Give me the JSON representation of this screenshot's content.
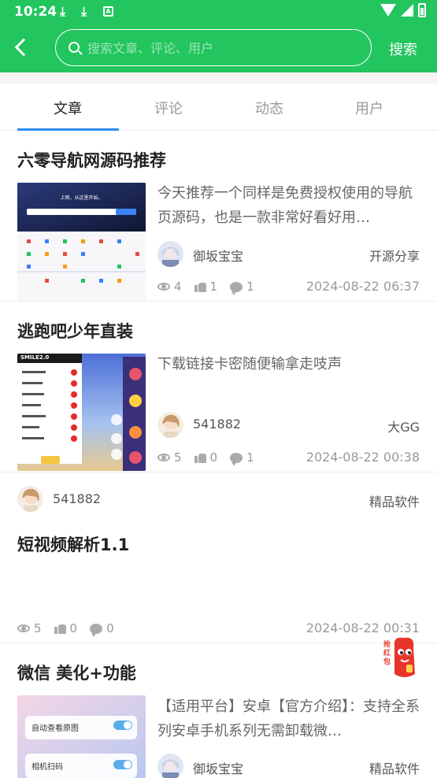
{
  "status_bar": {
    "time": "10:24"
  },
  "header": {
    "search_placeholder": "搜索文章、评论、用户",
    "search_button": "搜索"
  },
  "tabs": [
    {
      "label": "文章",
      "active": true
    },
    {
      "label": "评论",
      "active": false
    },
    {
      "label": "动态",
      "active": false
    },
    {
      "label": "用户",
      "active": false
    }
  ],
  "articles": [
    {
      "title": "六零导航网源码推荐",
      "excerpt": "今天推荐一个同样是免费授权使用的导航页源码，也是一款非常好看好用…",
      "author": "御坂宝宝",
      "category": "开源分享",
      "views": "4",
      "likes": "1",
      "comments": "1",
      "date": "2024-08-22 06:37",
      "thumb_caption": "上网，从这里开始。"
    },
    {
      "title": "逃跑吧少年直装",
      "excerpt": "下载链接卡密随便输拿走吱声",
      "author": "541882",
      "category": "大GG",
      "views": "5",
      "likes": "0",
      "comments": "1",
      "date": "2024-08-22 00:38",
      "thumb_caption": "SMILE2.0"
    },
    {
      "title": "短视频解析1.1",
      "author": "541882",
      "category": "精品软件",
      "views": "5",
      "likes": "0",
      "comments": "0",
      "date": "2024-08-22 00:31"
    },
    {
      "title": "微信 美化+功能",
      "excerpt": "【适用平台】安卓【官方介绍】：支持全系列安卓手机系列无需卸载微…",
      "author": "御坂宝宝",
      "category": "精品软件",
      "thumb_caption_1": "自动查看原图",
      "thumb_caption_2": "相机扫码"
    }
  ],
  "float_badge": {
    "label": "抢红包"
  },
  "colors": {
    "accent": "#22c55e",
    "tab_underline": "#2b8cf0"
  }
}
